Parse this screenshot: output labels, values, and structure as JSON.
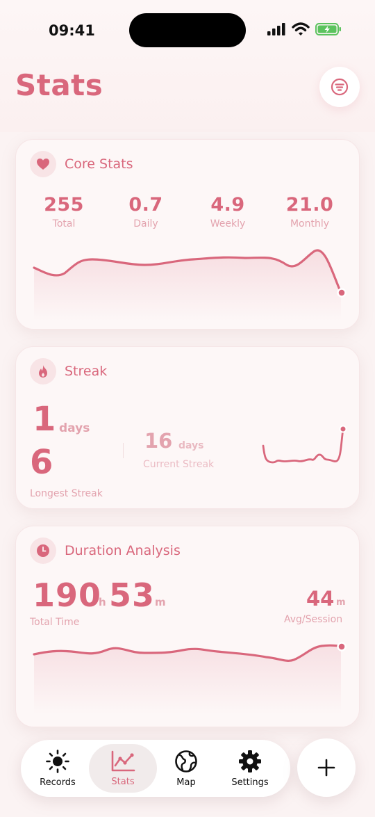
{
  "status_bar": {
    "time": "09:41"
  },
  "header": {
    "title": "Stats"
  },
  "core_stats": {
    "title": "Core Stats",
    "items": [
      {
        "value": "255",
        "label": "Total"
      },
      {
        "value": "0.7",
        "label": "Daily"
      },
      {
        "value": "4.9",
        "label": "Weekly"
      },
      {
        "value": "21.0",
        "label": "Monthly"
      }
    ]
  },
  "streak": {
    "title": "Streak",
    "value_days": "1",
    "days_unit": "days",
    "longest_value": "6",
    "longest_label": "Longest Streak",
    "current_value": "16",
    "current_unit": "days",
    "current_label": "Current Streak"
  },
  "duration": {
    "title": "Duration Analysis",
    "hours": "190",
    "hours_unit": "h",
    "minutes": "53",
    "minutes_unit": "m",
    "total_label": "Total Time",
    "avg_value": "44",
    "avg_unit": "m",
    "avg_label": "Avg/Session"
  },
  "nav": {
    "items": [
      {
        "label": "Records",
        "icon": "sun-icon",
        "active": false
      },
      {
        "label": "Stats",
        "icon": "chart-line-icon",
        "active": true
      },
      {
        "label": "Map",
        "icon": "globe-icon",
        "active": false
      },
      {
        "label": "Settings",
        "icon": "gear-icon",
        "active": false
      }
    ],
    "add_icon": "plus-icon"
  },
  "colors": {
    "accent": "#d9677c",
    "accent_muted": "#e3a3ae",
    "card_bg": "#fdf7f7",
    "page_bg": "#fbf3f3"
  }
}
